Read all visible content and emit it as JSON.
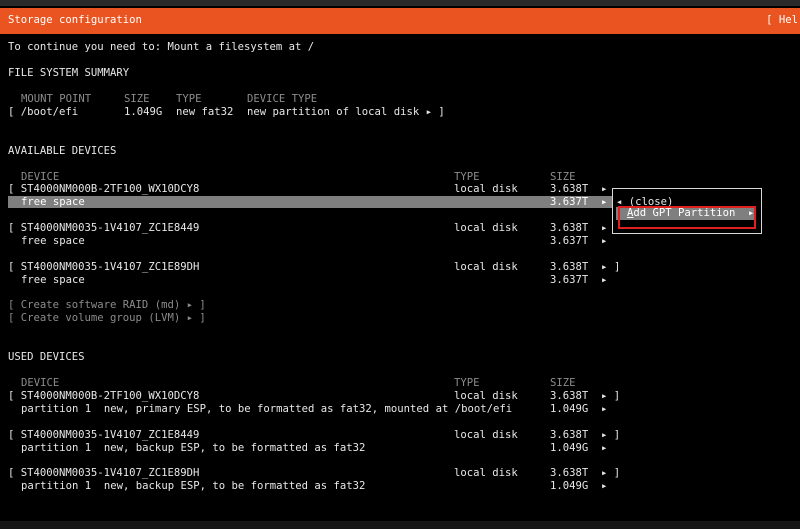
{
  "header": {
    "title": "Storage configuration",
    "help": "[ Hel"
  },
  "instruction": "To continue you need to: Mount a filesystem at /",
  "fs_summary": {
    "heading": "FILE SYSTEM SUMMARY",
    "columns": [
      "MOUNT POINT",
      "SIZE",
      "TYPE",
      "DEVICE TYPE"
    ],
    "rows": [
      {
        "mount": "[ /boot/efi",
        "size": "1.049G",
        "type": "new fat32",
        "device_type": "new partition of local disk ▸ ]"
      }
    ]
  },
  "available": {
    "heading": "AVAILABLE DEVICES",
    "columns": [
      "DEVICE",
      "TYPE",
      "SIZE"
    ],
    "devices": [
      {
        "name": "[ ST4000NM000B-2TF100_WX10DCY8",
        "type": "local disk",
        "size": "3.638T",
        "arrow": "▸",
        "close": "",
        "child": "free space",
        "child_size": "3.637T",
        "child_arrow": "▸"
      },
      {
        "name": "[ ST4000NM0035-1V4107_ZC1E8449",
        "type": "local disk",
        "size": "3.638T",
        "arrow": "▸",
        "close": "",
        "child": "free space",
        "child_size": "3.637T",
        "child_arrow": "▸"
      },
      {
        "name": "[ ST4000NM0035-1V4107_ZC1E89DH",
        "type": "local disk",
        "size": "3.638T",
        "arrow": "▸",
        "close": "]",
        "child": "free space",
        "child_size": "3.637T",
        "child_arrow": "▸"
      }
    ],
    "actions": [
      "[ Create software RAID (md) ▸ ]",
      "[ Create volume group (LVM) ▸ ]"
    ]
  },
  "popup": {
    "close_label": "◂ (close)",
    "add_gpt_prefix": "A",
    "add_gpt_rest": "dd GPT Partition",
    "add_gpt_arrow": "▸"
  },
  "used": {
    "heading": "USED DEVICES",
    "columns": [
      "DEVICE",
      "TYPE",
      "SIZE"
    ],
    "devices": [
      {
        "name": "[ ST4000NM000B-2TF100_WX10DCY8",
        "type": "local disk",
        "size": "3.638T",
        "arrow": "▸ ]",
        "child": "partition 1  new, primary ESP, to be formatted as fat32, mounted at /boot/efi",
        "child_size": "1.049G",
        "child_arrow": "▸"
      },
      {
        "name": "[ ST4000NM0035-1V4107_ZC1E8449",
        "type": "local disk",
        "size": "3.638T",
        "arrow": "▸ ]",
        "child": "partition 1  new, backup ESP, to be formatted as fat32",
        "child_size": "1.049G",
        "child_arrow": "▸"
      },
      {
        "name": "[ ST4000NM0035-1V4107_ZC1E89DH",
        "type": "local disk",
        "size": "3.638T",
        "arrow": "▸ ]",
        "child": "partition 1  new, backup ESP, to be formatted as fat32",
        "child_size": "1.049G",
        "child_arrow": "▸"
      }
    ]
  },
  "colors": {
    "accent": "#e95420",
    "highlight": "#7f7f7f",
    "annotation": "#e02020"
  }
}
